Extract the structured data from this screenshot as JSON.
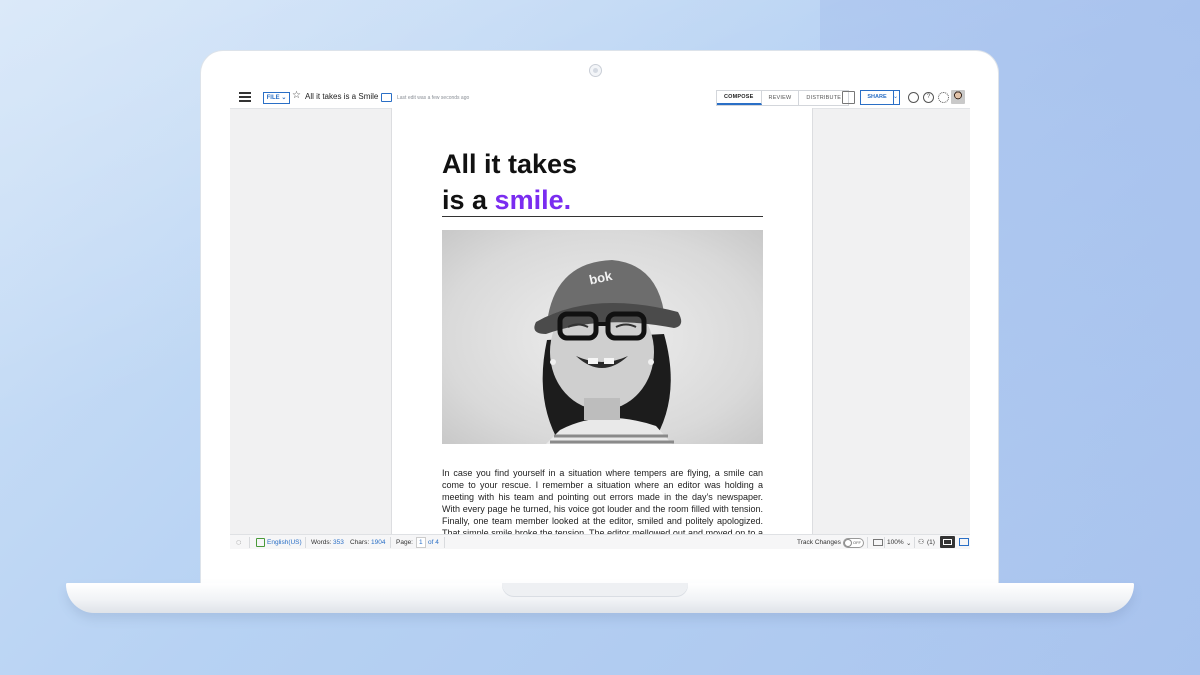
{
  "app": {
    "doc_title": "All it takes is a Smile",
    "last_edit": "Last edit was a few seconds ago",
    "file_label": "FILE",
    "caret": "⌄",
    "mode_tabs": [
      {
        "label": "COMPOSE",
        "active": true
      },
      {
        "label": "REVIEW",
        "active": false
      },
      {
        "label": "DISTRIBUTE",
        "active": false
      }
    ],
    "share_label": "SHARE",
    "help_glyph": "?",
    "icons": [
      "menu-icon",
      "star-icon",
      "folder-icon",
      "presentation-icon",
      "user-search-icon",
      "help-icon",
      "gear-icon",
      "avatar",
      "comment-icon",
      "language-icon",
      "keyboard-icon",
      "collaborators-icon",
      "reading-view-icon",
      "mail-icon"
    ]
  },
  "document": {
    "heading_line1": "All it takes",
    "heading_line2_plain": "is a ",
    "heading_line2_accent": "smile.",
    "accent_color": "#7a2cf0",
    "body": "In case you find yourself in a situation where tempers are flying, a smile can come to your rescue. I remember a situation where an editor was holding a meeting with his team and pointing out errors made in the day’s newspaper. With every page he turned, his voice got louder and the room filled with tension. Finally, one team member looked at the editor, smiled and politely apologized. That simple smile broke the tension. The editor mellowed out and moved on to a different subject."
  },
  "statusbar": {
    "language": "English(US)",
    "words_label": "Words:",
    "words_value": "353",
    "chars_label": "Chars:",
    "chars_value": "1904",
    "page_label": "Page:",
    "page_value": "1",
    "page_of": "of 4",
    "track_changes_label": "Track Changes",
    "track_changes_state": "OFF",
    "zoom": "100%",
    "collaborators": "(1)"
  },
  "colors": {
    "accent_blue": "#2a6fc6",
    "accent_purple": "#7a2cf0"
  }
}
